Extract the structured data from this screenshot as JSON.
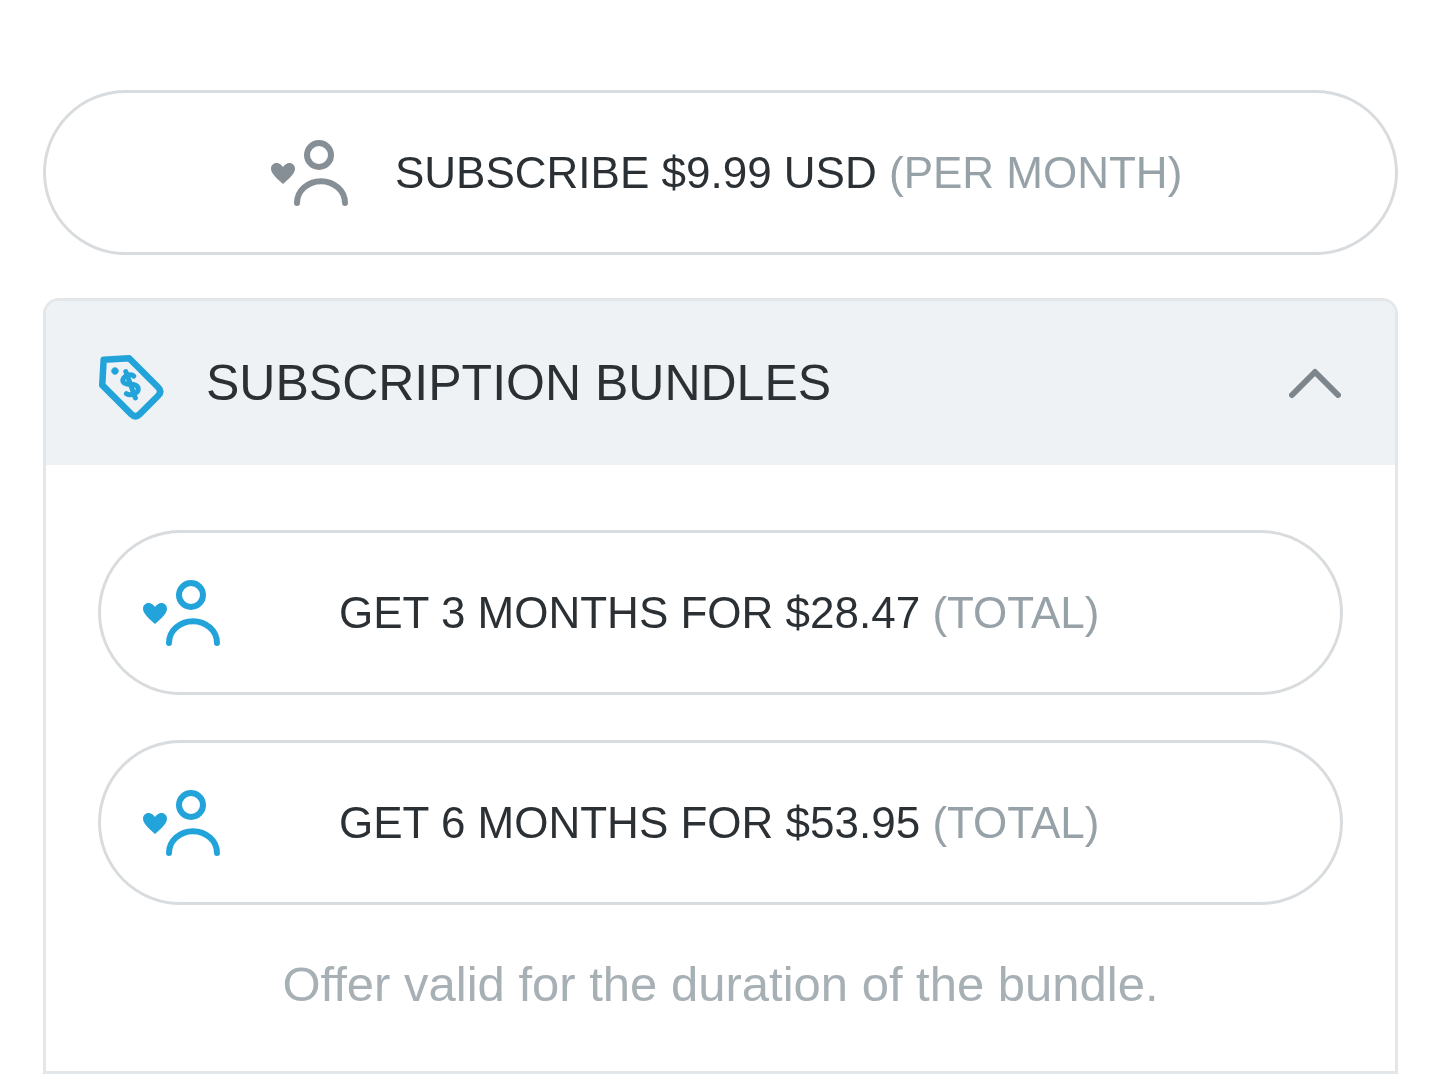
{
  "subscribe_button": {
    "label": "SUBSCRIBE $9.99 USD",
    "note": "(PER MONTH)"
  },
  "bundles_panel": {
    "title": "SUBSCRIPTION BUNDLES",
    "expanded": true,
    "options": [
      {
        "label": "GET 3 MONTHS FOR $28.47",
        "note": "(TOTAL)"
      },
      {
        "label": "GET 6 MONTHS FOR $53.95",
        "note": "(TOTAL)"
      }
    ],
    "footnote": "Offer valid for the duration of the bundle."
  }
}
